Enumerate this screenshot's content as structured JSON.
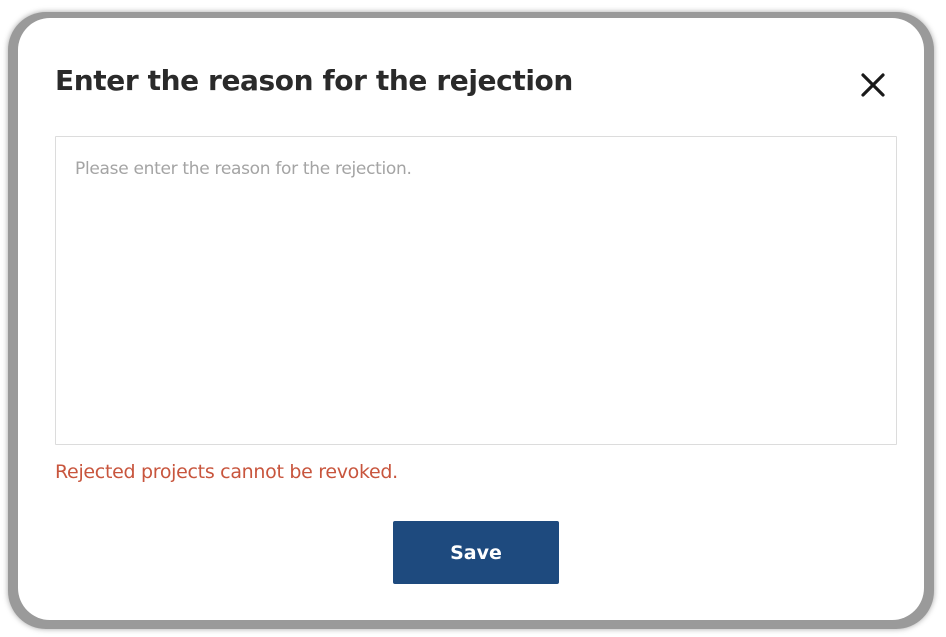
{
  "dialog": {
    "title": "Enter the reason for the rejection",
    "close_icon": "close-icon",
    "reason_field": {
      "value": "",
      "placeholder": "Please enter the reason for the rejection."
    },
    "warning_text": "Rejected projects cannot be revoked.",
    "save_label": "Save"
  },
  "colors": {
    "primary_button": "#1e4a7e",
    "warning_text": "#c8553d",
    "title_text": "#2a2a2a",
    "placeholder_text": "#a4a4a4"
  }
}
